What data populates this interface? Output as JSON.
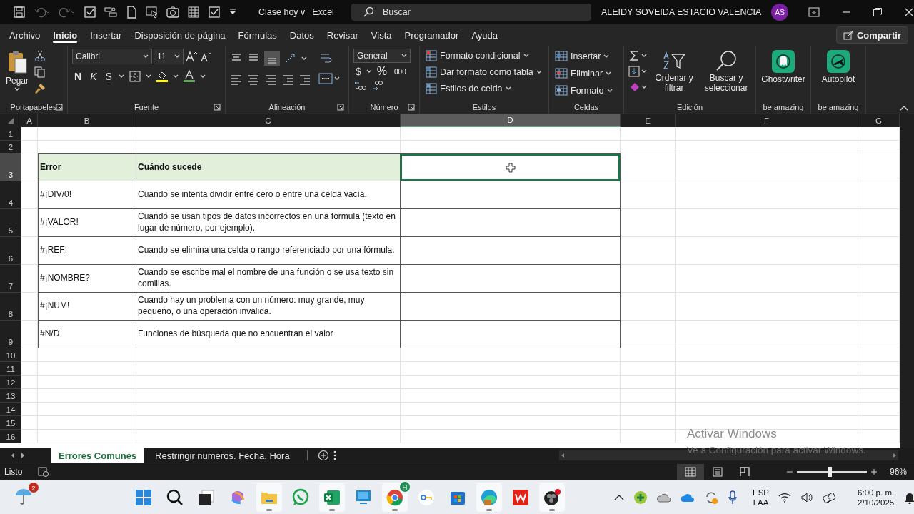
{
  "title_bar": {
    "title": "Clase hoy v",
    "app": "Excel",
    "search_placeholder": "Buscar",
    "user": "ALEIDY SOVEIDA ESTACIO VALENCIA",
    "avatar": "AS"
  },
  "ribbon_tabs": [
    {
      "label": "Archivo",
      "selected": false
    },
    {
      "label": "Inicio",
      "selected": true
    },
    {
      "label": "Insertar",
      "selected": false
    },
    {
      "label": "Disposición de página",
      "selected": false
    },
    {
      "label": "Fórmulas",
      "selected": false
    },
    {
      "label": "Datos",
      "selected": false
    },
    {
      "label": "Revisar",
      "selected": false
    },
    {
      "label": "Vista",
      "selected": false
    },
    {
      "label": "Programador",
      "selected": false
    },
    {
      "label": "Ayuda",
      "selected": false
    }
  ],
  "share_button": "Compartir",
  "ribbon": {
    "clipboard": {
      "paste": "Pegar",
      "label": "Portapapeles"
    },
    "font": {
      "name": "Calibri",
      "size": "11",
      "bold": "N",
      "italic": "K",
      "underline": "S",
      "label": "Fuente"
    },
    "alignment": {
      "label": "Alineación"
    },
    "number": {
      "format": "General",
      "currency": "$",
      "percent": "%",
      "thousands": "000",
      "label": "Número"
    },
    "styles": {
      "items": [
        "Formato condicional",
        "Dar formato como tabla",
        "Estilos de celda"
      ],
      "label": "Estilos"
    },
    "cells": {
      "items": [
        "Insertar",
        "Eliminar",
        "Formato"
      ],
      "label": "Celdas"
    },
    "editing": {
      "sort": "Ordenar y filtrar",
      "find": "Buscar y seleccionar",
      "label": "Edición"
    },
    "addins": [
      {
        "name": "Ghostwriter",
        "label": "be amazing"
      },
      {
        "name": "Autopilot",
        "label": "be amazing"
      }
    ]
  },
  "sheet": {
    "columns": [
      {
        "label": "A",
        "selected": false
      },
      {
        "label": "B",
        "selected": false
      },
      {
        "label": "C",
        "selected": false
      },
      {
        "label": "D",
        "selected": true
      },
      {
        "label": "E",
        "selected": false
      },
      {
        "label": "F",
        "selected": false
      },
      {
        "label": "G",
        "selected": false
      }
    ],
    "rows": [
      {
        "number": "1",
        "selected": false
      },
      {
        "number": "2",
        "selected": false
      },
      {
        "number": "3",
        "selected": true
      },
      {
        "number": "4",
        "selected": false
      },
      {
        "number": "5",
        "selected": false
      },
      {
        "number": "6",
        "selected": false
      },
      {
        "number": "7",
        "selected": false
      },
      {
        "number": "8",
        "selected": false
      },
      {
        "number": "9",
        "selected": false
      },
      {
        "number": "10",
        "selected": false
      },
      {
        "number": "11",
        "selected": false
      },
      {
        "number": "12",
        "selected": false
      },
      {
        "number": "13",
        "selected": false
      },
      {
        "number": "14",
        "selected": false
      },
      {
        "number": "15",
        "selected": false
      },
      {
        "number": "16",
        "selected": false
      }
    ],
    "table": {
      "header": [
        "Error",
        "Cuándo sucede"
      ],
      "rows": [
        [
          "#¡DIV/0!",
          "Cuando se intenta dividir entre cero o entre una celda vacía."
        ],
        [
          "#¡VALOR!",
          "Cuando se usan tipos de datos incorrectos en una fórmula (texto en lugar de número, por ejemplo)."
        ],
        [
          "#¡REF!",
          "Cuando se elimina una celda o rango referenciado por una fórmula."
        ],
        [
          "#¡NOMBRE?",
          "Cuando se escribe mal el nombre de una función o se usa texto sin comillas."
        ],
        [
          "#¡NUM!",
          "Cuando hay un problema con un número: muy grande, muy pequeño, o una operación inválida."
        ],
        [
          "#N/D",
          "Funciones de búsqueda que no encuentran el valor"
        ]
      ]
    }
  },
  "sheet_tabs": [
    {
      "label": "Errores Comunes",
      "selected": true
    },
    {
      "label": "Restringir numeros. Fecha. Hora",
      "selected": false
    }
  ],
  "activation": {
    "title": "Activar Windows",
    "subtitle": "Ve a Configuración para activar Windows."
  },
  "status_bar": {
    "status": "Listo",
    "views": [
      {
        "kind": "normal",
        "selected": true
      },
      {
        "kind": "page_layout",
        "selected": false
      },
      {
        "kind": "page_break",
        "selected": false
      }
    ],
    "zoom": {
      "level": 0.47,
      "reading": "96%"
    }
  },
  "taskbar": {
    "weather_badge": "2",
    "apps": [
      {
        "kind": "start",
        "running": false
      },
      {
        "kind": "search",
        "running": false
      },
      {
        "kind": "taskview",
        "running": false
      },
      {
        "kind": "copilot",
        "running": false
      },
      {
        "kind": "files",
        "running": true
      },
      {
        "kind": "whatsapp",
        "running": false
      },
      {
        "kind": "excel",
        "running": true
      },
      {
        "kind": "monitor",
        "running": false
      },
      {
        "kind": "chrome",
        "running": true,
        "badge": "H"
      },
      {
        "kind": "keys",
        "running": false
      },
      {
        "kind": "store",
        "running": false
      },
      {
        "kind": "edge",
        "running": true
      },
      {
        "kind": "wps",
        "running": false
      },
      {
        "kind": "obs",
        "running": true
      }
    ],
    "language": [
      "ESP",
      "LAA"
    ],
    "time": "6:00 p. m.",
    "date": "2/10/2025"
  }
}
